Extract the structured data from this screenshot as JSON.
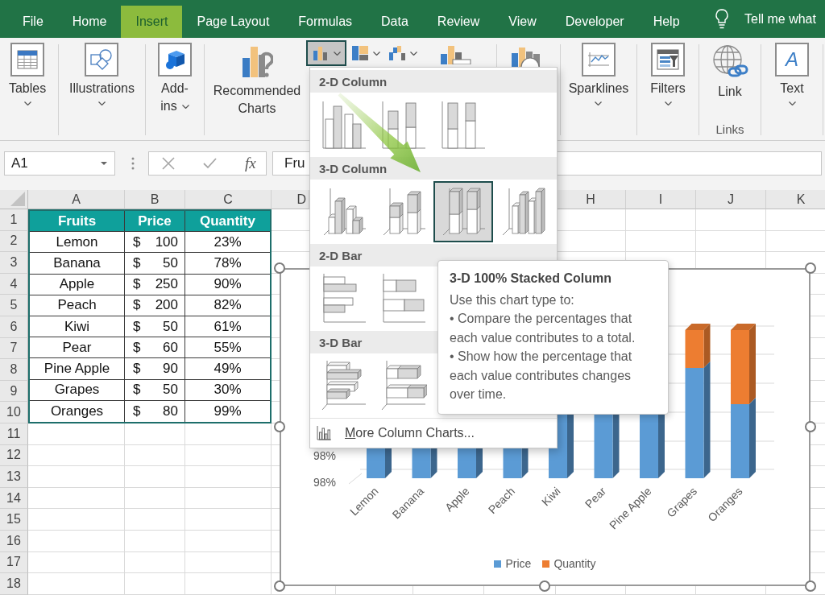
{
  "tabs": [
    {
      "label": "File",
      "selected": false
    },
    {
      "label": "Home",
      "selected": false
    },
    {
      "label": "Insert",
      "selected": true
    },
    {
      "label": "Page Layout",
      "selected": false
    },
    {
      "label": "Formulas",
      "selected": false
    },
    {
      "label": "Data",
      "selected": false
    },
    {
      "label": "Review",
      "selected": false
    },
    {
      "label": "View",
      "selected": false
    },
    {
      "label": "Developer",
      "selected": false
    },
    {
      "label": "Help",
      "selected": false
    }
  ],
  "search": {
    "placeholder": "Tell me what"
  },
  "ribbon": {
    "groups": [
      {
        "kind": "large",
        "label": "Tables",
        "dropdown": true
      },
      {
        "kind": "large",
        "label": "Illustrations",
        "dropdown": true
      },
      {
        "kind": "large",
        "label": "Add-ins",
        "dropdown": true
      },
      {
        "kind": "charts",
        "label": "Recommended Charts",
        "chart_buttons": [
          {
            "selected": true
          },
          {
            "selected": false
          },
          {
            "selected": false
          }
        ]
      },
      {
        "kind": "large",
        "label": "Sparklines",
        "dropdown": true
      },
      {
        "kind": "large",
        "label": "Filters",
        "dropdown": true
      },
      {
        "kind": "large",
        "label": "Link",
        "dropdown": false,
        "group_label": "Links"
      },
      {
        "kind": "large",
        "label": "Text",
        "dropdown": true,
        "glyph": "A"
      }
    ]
  },
  "name_box": {
    "value": "A1"
  },
  "formula_bar": {
    "function_label": "fx",
    "value": "Fru"
  },
  "sheet": {
    "column_headers": [
      "A",
      "B",
      "C",
      "D",
      "H",
      "I",
      "J",
      "K"
    ],
    "row_numbers": [
      "1",
      "2",
      "3",
      "4",
      "5",
      "6",
      "7",
      "8",
      "9",
      "10",
      "11",
      "12",
      "13",
      "14",
      "15",
      "16",
      "17",
      "18"
    ]
  },
  "table": {
    "columns": [
      "Fruits",
      "Price",
      "Quantity"
    ],
    "rows": [
      {
        "fruit": "Lemon",
        "currency": "$",
        "price": "100",
        "quantity": "23%"
      },
      {
        "fruit": "Banana",
        "currency": "$",
        "price": "50",
        "quantity": "78%"
      },
      {
        "fruit": "Apple",
        "currency": "$",
        "price": "250",
        "quantity": "90%"
      },
      {
        "fruit": "Peach",
        "currency": "$",
        "price": "200",
        "quantity": "82%"
      },
      {
        "fruit": "Kiwi",
        "currency": "$",
        "price": "50",
        "quantity": "61%"
      },
      {
        "fruit": "Pear",
        "currency": "$",
        "price": "60",
        "quantity": "55%"
      },
      {
        "fruit": "Pine Apple",
        "currency": "$",
        "price": "90",
        "quantity": "49%"
      },
      {
        "fruit": "Grapes",
        "currency": "$",
        "price": "50",
        "quantity": "30%"
      },
      {
        "fruit": "Oranges",
        "currency": "$",
        "price": "80",
        "quantity": "99%"
      }
    ]
  },
  "chart": {
    "y_labels": [
      "98%",
      "98%"
    ],
    "categories": [
      "Lemon",
      "Banana",
      "Apple",
      "Peach",
      "Kiwi",
      "Pear",
      "Pine Apple",
      "Grapes",
      "Oranges"
    ],
    "legend": [
      {
        "label": "Price",
        "color": "#5b9bd5"
      },
      {
        "label": "Quantity",
        "color": "#ed7d31"
      }
    ]
  },
  "chart_gallery": {
    "sections": [
      {
        "title": "2-D Column",
        "options": [
          {
            "selected": false
          },
          {
            "selected": false
          },
          {
            "selected": false
          }
        ]
      },
      {
        "title": "3-D Column",
        "options": [
          {
            "selected": false
          },
          {
            "selected": false
          },
          {
            "selected": true
          },
          {
            "selected": false
          }
        ]
      },
      {
        "title": "2-D Bar",
        "options": [
          {
            "selected": false
          },
          {
            "selected": false
          }
        ]
      },
      {
        "title": "3-D Bar",
        "options": [
          {
            "selected": false
          },
          {
            "selected": false
          }
        ]
      }
    ],
    "more": "More Column Charts..."
  },
  "tooltip": {
    "title": "3-D 100% Stacked Column",
    "intro": "Use this chart type to:",
    "bullets": [
      "• Compare the percentages that each value contributes to a total.",
      "• Show how the percentage that each value contributes changes over time."
    ]
  }
}
